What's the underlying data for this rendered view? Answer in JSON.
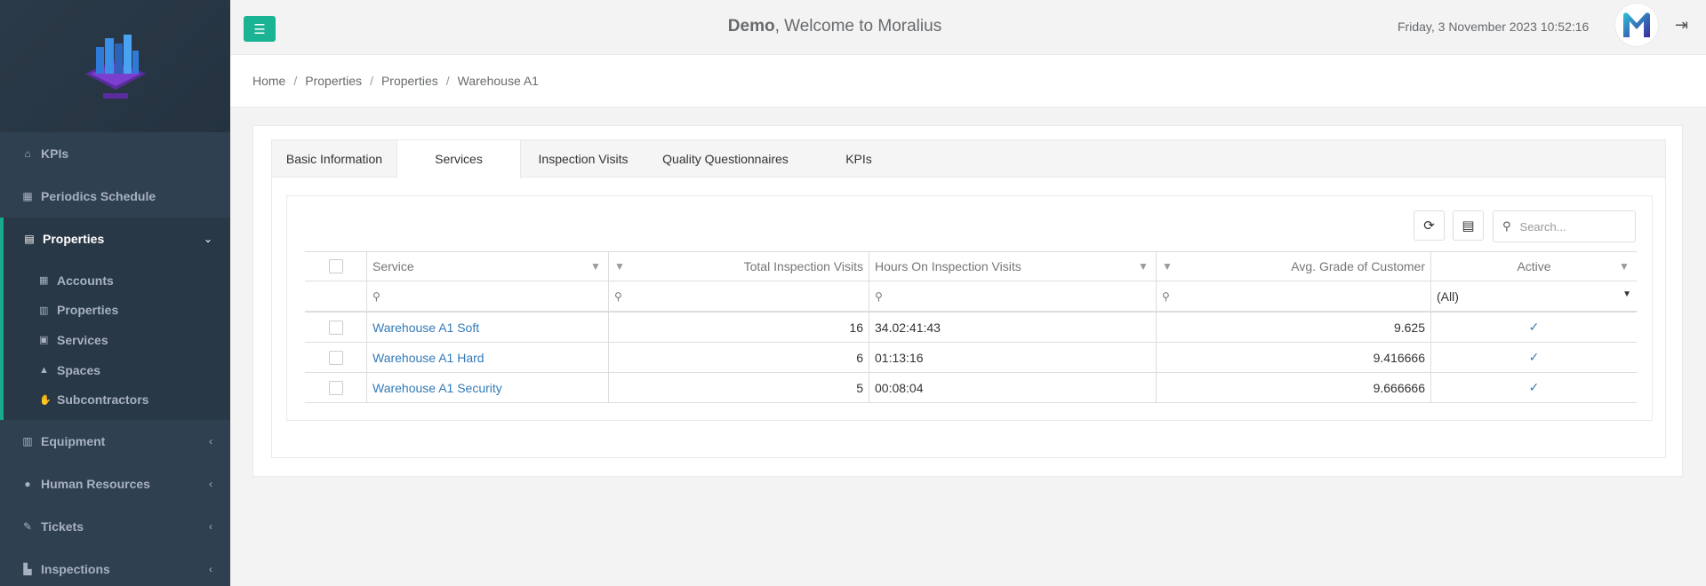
{
  "sidebar": {
    "items": [
      {
        "label": "KPIs",
        "icon": "home-icon"
      },
      {
        "label": "Periodics Schedule",
        "icon": "calendar-icon"
      },
      {
        "label": "Properties",
        "icon": "calculator-icon"
      },
      {
        "label": "Equipment",
        "icon": "building-icon"
      },
      {
        "label": "Human Resources",
        "icon": "users-icon"
      },
      {
        "label": "Tickets",
        "icon": "ticket-icon"
      },
      {
        "label": "Inspections",
        "icon": "map-icon"
      }
    ],
    "subitems": [
      {
        "label": "Accounts",
        "icon": "table-icon"
      },
      {
        "label": "Properties",
        "icon": "building-icon"
      },
      {
        "label": "Services",
        "icon": "calendar-check-icon"
      },
      {
        "label": "Spaces",
        "icon": "tree-icon"
      },
      {
        "label": "Subcontractors",
        "icon": "hand-icon"
      }
    ]
  },
  "topbar": {
    "user": "Demo",
    "welcome": ", Welcome to Moralius",
    "datetime": "Friday, 3 November 2023 10:52:16"
  },
  "breadcrumb": [
    "Home",
    "Properties",
    "Properties",
    "Warehouse A1"
  ],
  "tabs": [
    "Basic Information",
    "Services",
    "Inspection Visits",
    "Quality Questionnaires",
    "KPIs"
  ],
  "grid": {
    "search_placeholder": "Search...",
    "columns": [
      "Service",
      "Total Inspection Visits",
      "Hours On Inspection Visits",
      "Avg. Grade of Customer",
      "Active"
    ],
    "active_filter": "(All)",
    "rows": [
      {
        "service": "Warehouse A1 Soft",
        "visits": "16",
        "hours": "34.02:41:43",
        "grade": "9.625",
        "active": "✓"
      },
      {
        "service": "Warehouse A1 Hard",
        "visits": "6",
        "hours": "01:13:16",
        "grade": "9.416666",
        "active": "✓"
      },
      {
        "service": "Warehouse A1 Security",
        "visits": "5",
        "hours": "00:08:04",
        "grade": "9.666666",
        "active": "✓"
      }
    ]
  },
  "colors": {
    "accent": "#1ab394",
    "sidebar": "#2f4050",
    "link": "#337ab7"
  }
}
